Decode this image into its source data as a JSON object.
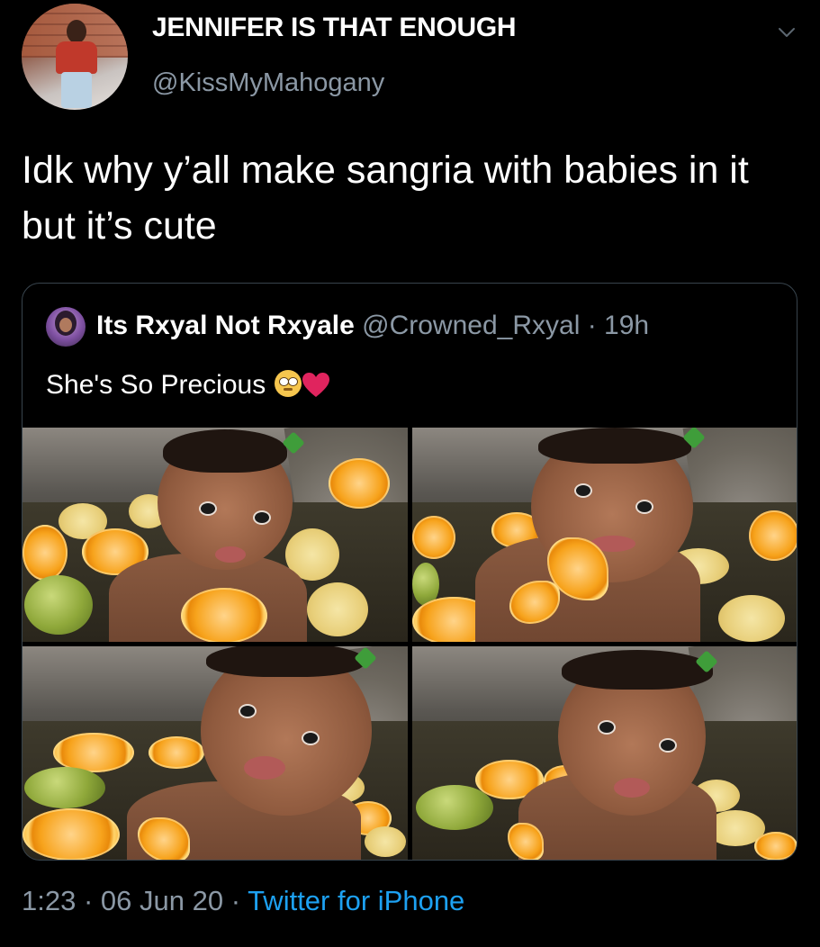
{
  "author": {
    "display_name": "JENNIFER IS THAT ENOUGH",
    "handle": "@KissMyMahogany"
  },
  "tweet": {
    "text": "Idk why y’all make sangria with babies in it but it’s cute"
  },
  "quoted_tweet": {
    "display_name": "Its Rxyal Not Rxyale",
    "handle": "@Crowned_Rxyal",
    "separator": "·",
    "time": "19h",
    "text": "She's So Precious",
    "emojis": [
      "face-with-rolling-eyes-icon",
      "red-heart-icon"
    ],
    "photo_count": 4
  },
  "footer": {
    "time": "1:23",
    "separator1": " · ",
    "date": "06 Jun 20",
    "separator2": " · ",
    "source": "Twitter for iPhone"
  },
  "colors": {
    "background": "#000000",
    "primary_text": "#ffffff",
    "secondary_text": "#8b98a5",
    "link": "#1da1f2",
    "border": "#38444d",
    "heart": "#e0245e"
  }
}
